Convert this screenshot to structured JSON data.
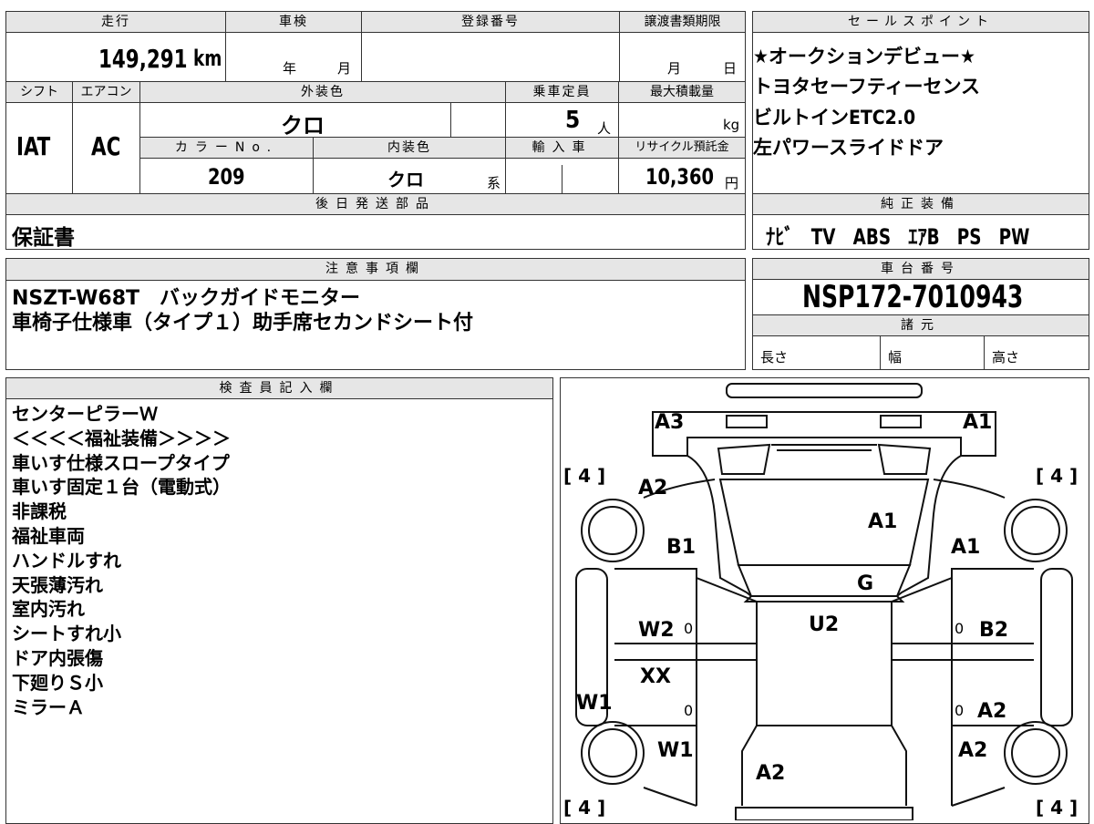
{
  "vehicle": {
    "headers": {
      "mileage": "走行",
      "inspection": "車検",
      "registration": "登録番号",
      "transfer_deadline": "譲渡書類期限",
      "shift": "シフト",
      "aircon": "エアコン",
      "exterior_color": "外装色",
      "capacity": "乗車定員",
      "max_load": "最大積載量",
      "color_no": "カラーNo.",
      "interior_color": "内装色",
      "import": "輸入車",
      "recycle": "リサイクル預託金",
      "deferred_parts": "後日発送部品",
      "notes": "注意事項欄",
      "sales_points": "セールスポイント",
      "equipment": "純正装備",
      "chassis": "車台番号",
      "specs": "諸元",
      "inspector": "検査員記入欄"
    },
    "mileage": "149,291",
    "mileage_unit": "km",
    "year_unit": "年",
    "month_unit": "月",
    "month_unit2": "月",
    "day_unit": "日",
    "shift": "IAT",
    "aircon": "AC",
    "exterior_color": "クロ",
    "capacity": "5",
    "capacity_unit": "人",
    "max_load_unit": "kg",
    "color_no": "209",
    "interior_color": "クロ",
    "interior_suffix": "系",
    "recycle": "10,360",
    "recycle_unit": "円",
    "deferred_parts": "保証書",
    "notes": [
      "NSZT-W68T　バックガイドモニター",
      "車椅子仕様車（タイプ１）助手席セカンドシート付"
    ],
    "sales_points": [
      "★オークションデビュー★",
      "トヨタセーフティーセンス",
      "ビルトインETC2.0",
      "左パワースライドドア"
    ],
    "equipment": [
      "ﾅﾋﾞ",
      "TV",
      "ABS",
      "ｴｱB",
      "PS",
      "PW"
    ],
    "chassis": "NSP172-7010943",
    "specs": {
      "length": "長さ",
      "width": "幅",
      "height": "高さ"
    },
    "inspector_notes": [
      "センターピラーＷ",
      "＜＜＜＜福祉装備＞＞＞＞",
      "車いす仕様スロープタイプ",
      "車いす固定１台（電動式）",
      "非課税",
      "福祉車両",
      "ハンドルすれ",
      "天張薄汚れ",
      "室内汚れ",
      "シートすれ小",
      "ドア内張傷",
      "下廻りＳ小",
      "ミラーＡ"
    ]
  },
  "diagram": {
    "labels": {
      "a3": "A3",
      "a1_top": "A1",
      "a2_tl": "A2",
      "a1_roof": "A1",
      "b1": "B1",
      "a1_right": "A1",
      "g": "G",
      "u2": "U2",
      "w2": "W2",
      "b2": "B2",
      "xx": "XX",
      "w1_left": "W1",
      "a2_r": "A2",
      "w1": "W1",
      "a2_rl": "A2",
      "a2_bottom": "A2"
    },
    "tires": [
      "[ 4 ]",
      "[ 4 ]",
      "[ 4 ]",
      "[ 4 ]"
    ],
    "zeros": [
      "0",
      "0",
      "0",
      "0"
    ]
  }
}
